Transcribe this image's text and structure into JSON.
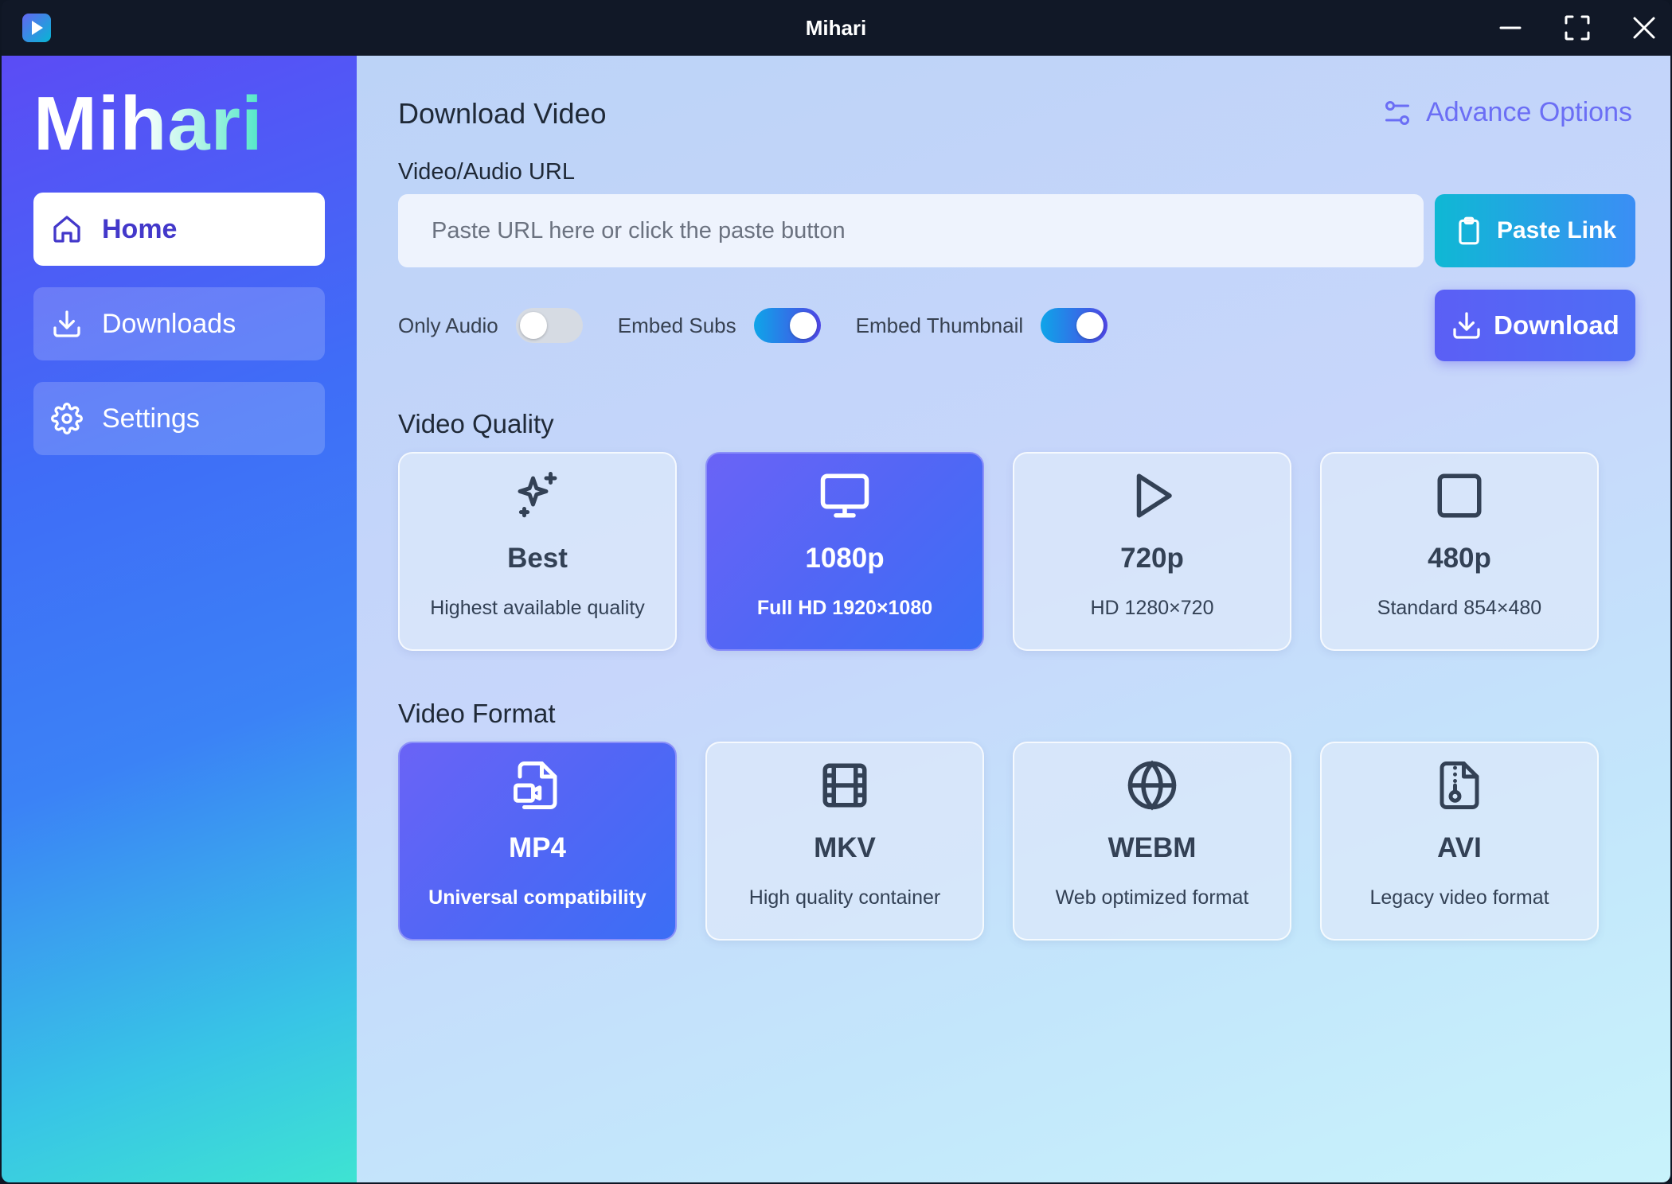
{
  "window": {
    "title": "Mihari",
    "controls": [
      "minimize-icon",
      "maximize-icon",
      "close-icon"
    ]
  },
  "sidebar": {
    "logo": "Mihari",
    "items": [
      {
        "label": "Home",
        "icon": "home-icon",
        "active": true
      },
      {
        "label": "Downloads",
        "icon": "download-icon",
        "active": false
      },
      {
        "label": "Settings",
        "icon": "gear-icon",
        "active": false
      }
    ]
  },
  "main": {
    "heading": "Download Video",
    "advance_options": "Advance Options",
    "url_label": "Video/Audio URL",
    "url_placeholder": "Paste URL here or click the paste button",
    "url_value": "",
    "paste_button": "Paste Link",
    "download_button": "Download",
    "toggles": [
      {
        "label": "Only Audio",
        "on": false
      },
      {
        "label": "Embed Subs",
        "on": true
      },
      {
        "label": "Embed Thumbnail",
        "on": true
      }
    ],
    "quality_heading": "Video Quality",
    "quality_options": [
      {
        "title": "Best",
        "desc": "Highest available quality",
        "icon": "sparkles-icon",
        "selected": false
      },
      {
        "title": "1080p",
        "desc": "Full HD 1920×1080",
        "icon": "monitor-icon",
        "selected": true
      },
      {
        "title": "720p",
        "desc": "HD 1280×720",
        "icon": "play-icon",
        "selected": false
      },
      {
        "title": "480p",
        "desc": "Standard 854×480",
        "icon": "square-icon",
        "selected": false
      }
    ],
    "format_heading": "Video Format",
    "format_options": [
      {
        "title": "MP4",
        "desc": "Universal compatibility",
        "icon": "file-video-icon",
        "selected": true
      },
      {
        "title": "MKV",
        "desc": "High quality container",
        "icon": "film-icon",
        "selected": false
      },
      {
        "title": "WEBM",
        "desc": "Web optimized format",
        "icon": "globe-icon",
        "selected": false
      },
      {
        "title": "AVI",
        "desc": "Legacy video format",
        "icon": "file-archive-icon",
        "selected": false
      }
    ]
  },
  "colors": {
    "accent": "#4f46e5",
    "selected_card": "#5b67f5",
    "titlebar": "#111827",
    "toggle_on": "#0ea5e9"
  }
}
